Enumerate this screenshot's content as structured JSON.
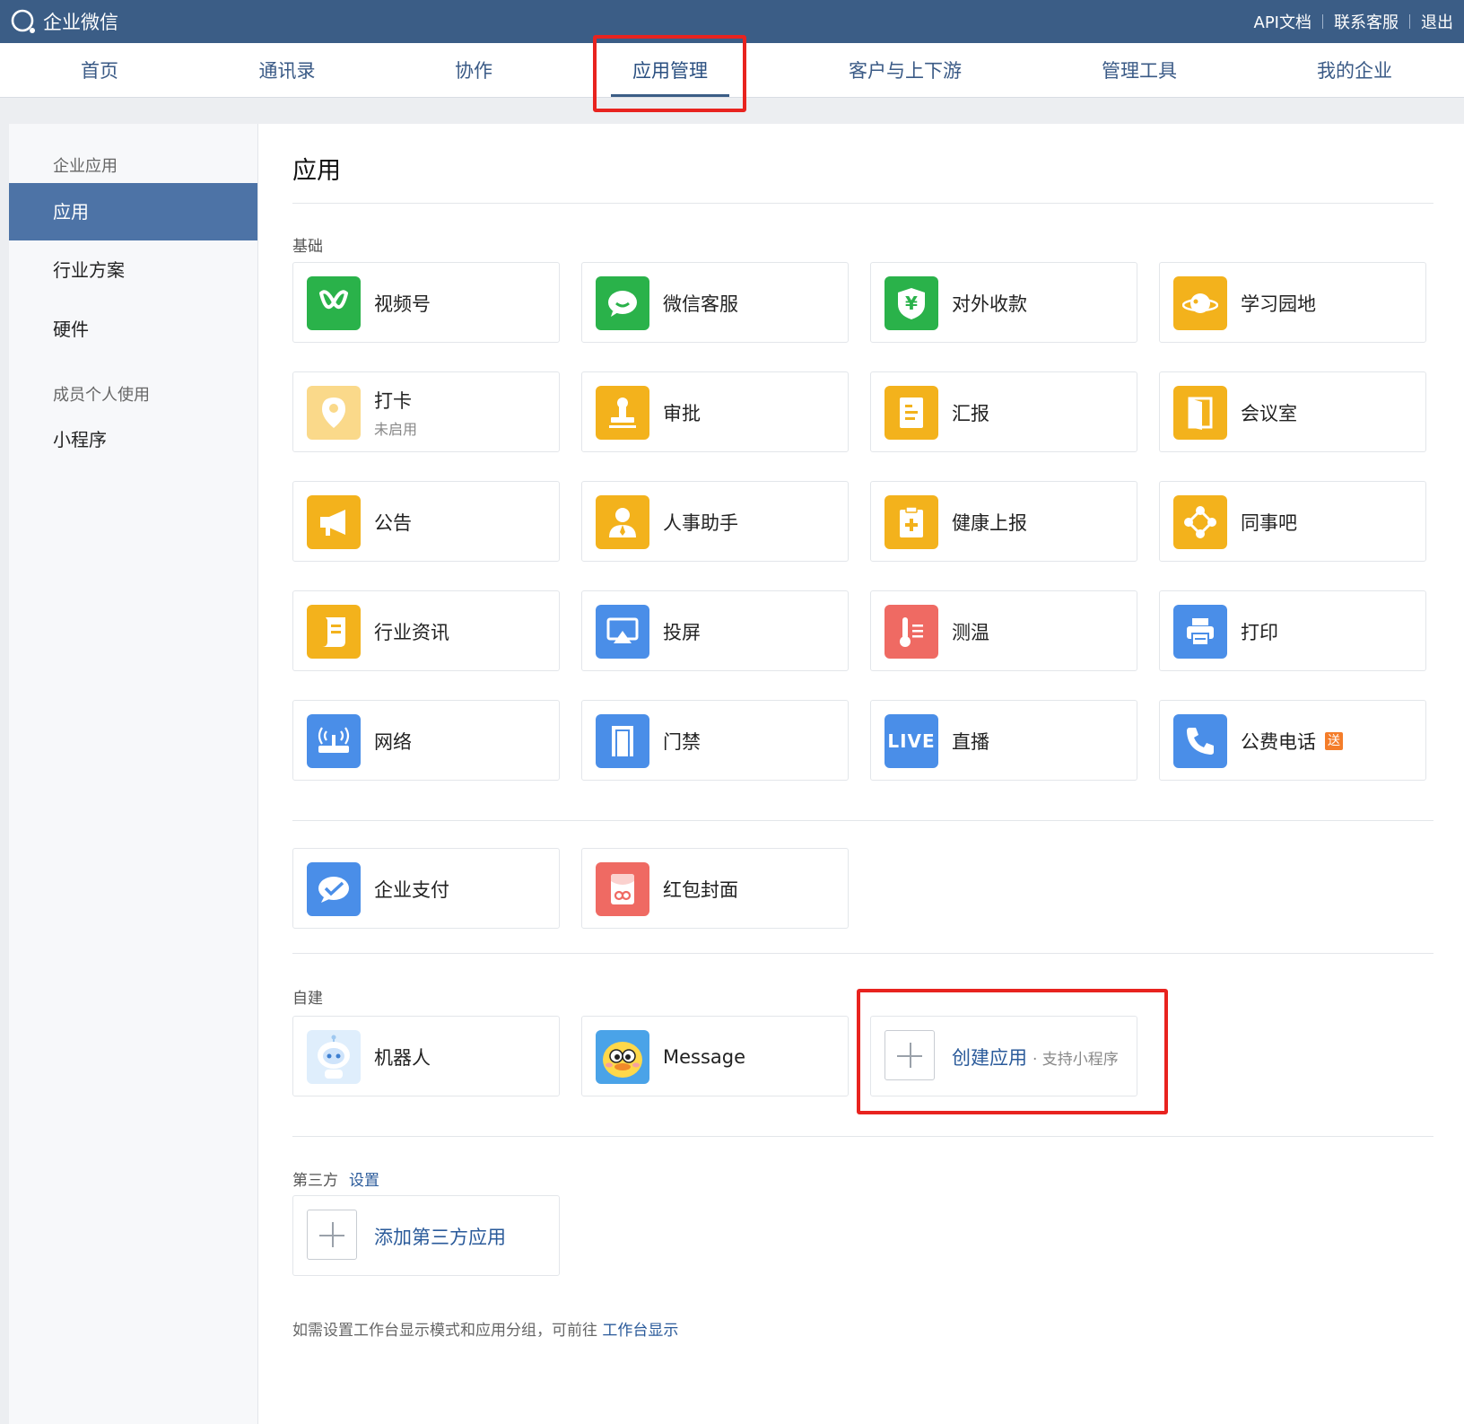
{
  "topbar": {
    "brand": "企业微信",
    "links": [
      "API文档",
      "联系客服",
      "退出"
    ]
  },
  "nav": {
    "items": [
      "首页",
      "通讯录",
      "协作",
      "应用管理",
      "客户与上下游",
      "管理工具",
      "我的企业"
    ],
    "active": "应用管理"
  },
  "sidebar": {
    "group1": "企业应用",
    "items1": [
      "应用",
      "行业方案",
      "硬件"
    ],
    "group2": "成员个人使用",
    "items2": [
      "小程序"
    ],
    "active": "应用"
  },
  "main": {
    "title": "应用",
    "basic_label": "基础",
    "basic_apps": [
      {
        "name": "视频号",
        "icon": "channels-icon",
        "color": "#2ab24a"
      },
      {
        "name": "微信客服",
        "icon": "chat-bubble-icon",
        "color": "#2ab24a"
      },
      {
        "name": "对外收款",
        "icon": "yuan-shield-icon",
        "color": "#2ab24a"
      },
      {
        "name": "学习园地",
        "icon": "planet-icon",
        "color": "#f3b21c"
      },
      {
        "name": "打卡",
        "status": "未启用",
        "icon": "location-pin-icon",
        "color": "#fad98a"
      },
      {
        "name": "审批",
        "icon": "stamp-icon",
        "color": "#f3b21c"
      },
      {
        "name": "汇报",
        "icon": "report-icon",
        "color": "#f3b21c"
      },
      {
        "name": "会议室",
        "icon": "door-icon",
        "color": "#f3b21c"
      },
      {
        "name": "公告",
        "icon": "megaphone-icon",
        "color": "#f3b21c"
      },
      {
        "name": "人事助手",
        "icon": "person-icon",
        "color": "#f3b21c"
      },
      {
        "name": "健康上报",
        "icon": "clipboard-plus-icon",
        "color": "#f3b21c"
      },
      {
        "name": "同事吧",
        "icon": "molecule-icon",
        "color": "#f3b21c"
      },
      {
        "name": "行业资讯",
        "icon": "scroll-icon",
        "color": "#f3b21c"
      },
      {
        "name": "投屏",
        "icon": "airplay-icon",
        "color": "#4a8ee8"
      },
      {
        "name": "测温",
        "icon": "thermometer-icon",
        "color": "#ef6a63"
      },
      {
        "name": "打印",
        "icon": "printer-icon",
        "color": "#4a8ee8"
      },
      {
        "name": "网络",
        "icon": "router-icon",
        "color": "#4a8ee8"
      },
      {
        "name": "门禁",
        "icon": "door-frame-icon",
        "color": "#4a8ee8"
      },
      {
        "name": "直播",
        "icon": "live-icon",
        "icon_text": "LIVE",
        "color": "#4a8ee8"
      },
      {
        "name": "公费电话",
        "badge": "送",
        "icon": "phone-icon",
        "color": "#4a8ee8"
      }
    ],
    "pay_apps": [
      {
        "name": "企业支付",
        "icon": "pay-check-icon",
        "color": "#4a8ee8"
      },
      {
        "name": "红包封面",
        "icon": "red-envelope-icon",
        "color": "#ef6a63"
      }
    ],
    "custom_label": "自建",
    "custom_apps": [
      {
        "name": "机器人",
        "icon": "robot-icon"
      },
      {
        "name": "Message",
        "icon": "duck-avatar-icon"
      }
    ],
    "create_app": {
      "label": "创建应用",
      "sub": "· 支持小程序"
    },
    "third_label": "第三方",
    "third_settings": "设置",
    "add_third": "添加第三方应用",
    "footer_text": "如需设置工作台显示模式和应用分组，可前往",
    "footer_link": "工作台显示"
  }
}
